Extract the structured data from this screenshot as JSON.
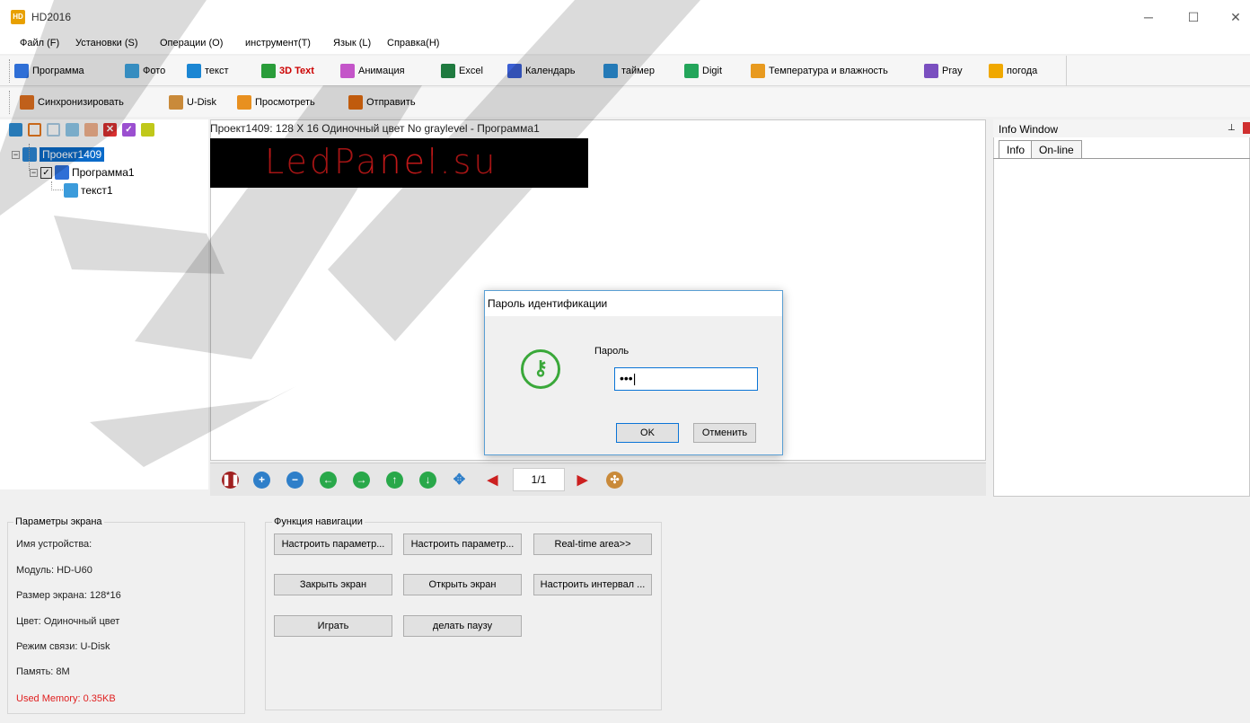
{
  "window": {
    "title": "HD2016",
    "icon_text": "HD"
  },
  "menu": [
    "Файл (F)",
    "Установки (S)",
    "Операции (O)",
    "инструмент(T)",
    "Язык (L)",
    "Справка(H)"
  ],
  "toolbar1": [
    {
      "label": "Программа",
      "icon": "program-icon",
      "color": "#2f6fd6"
    },
    {
      "label": "Фото",
      "icon": "photo-icon",
      "color": "#3fa5e0"
    },
    {
      "label": "текст",
      "icon": "text-icon",
      "color": "#1b86d3"
    },
    {
      "label": "3D Text",
      "icon": "cube-icon",
      "color": "#2a9d3a",
      "highlight": "#cc0000"
    },
    {
      "label": "Анимация",
      "icon": "animation-icon",
      "color": "#c455c9"
    },
    {
      "label": "Excel",
      "icon": "excel-icon",
      "color": "#1f7a3f"
    },
    {
      "label": "Календарь",
      "icon": "calendar-icon",
      "color": "#3b5fd3"
    },
    {
      "label": "таймер",
      "icon": "timer-icon",
      "color": "#2b8fd6"
    },
    {
      "label": "Digit",
      "icon": "digit-icon",
      "color": "#23a55a"
    },
    {
      "label": "Температура и влажность",
      "icon": "thermometer-icon",
      "color": "#e89a1f"
    },
    {
      "label": "Pray",
      "icon": "pray-icon",
      "color": "#7a4fc0"
    },
    {
      "label": "погода",
      "icon": "weather-icon",
      "color": "#f0a800"
    }
  ],
  "toolbar2": [
    {
      "label": "Синхронизировать",
      "icon": "sync-icon",
      "color": "#e07020"
    },
    {
      "label": "U-Disk",
      "icon": "usb-icon",
      "color": "#c98a3a"
    },
    {
      "label": "Просмотреть",
      "icon": "preview-icon",
      "color": "#e89020"
    },
    {
      "label": "Отправить",
      "icon": "send-icon",
      "color": "#e06a10"
    }
  ],
  "tree": {
    "project": "Проект1409",
    "program": "Программа1",
    "text": "текст1"
  },
  "canvas": {
    "header": "Проект1409: 128 X 16  Одиночный цвет No graylevel - Программа1",
    "led_text": "LedPanel.su"
  },
  "navigation": {
    "page": "1/1"
  },
  "info_window": {
    "title": "Info Window",
    "tabs": [
      "Info",
      "On-line"
    ]
  },
  "screen_params": {
    "title": "Параметры экрана",
    "lines": [
      "Имя устройства:",
      "Модуль: HD-U60",
      "Размер экрана: 128*16",
      "Цвет: Одиночный цвет",
      "Режим связи: U-Disk",
      "Память: 8M"
    ],
    "used_memory": "Used Memory: 0.35KB"
  },
  "nav_function": {
    "title": "Функция навигации",
    "buttons": [
      "Настроить параметр...",
      "Настроить параметр...",
      "Real-time area>>",
      "Закрыть экран",
      "Открыть экран",
      "Настроить интервал ...",
      "Играть",
      "делать паузу"
    ]
  },
  "dialog": {
    "title": "Пароль идентификации",
    "label": "Пароль",
    "value": "•••",
    "ok": "OK",
    "cancel": "Отменить"
  }
}
